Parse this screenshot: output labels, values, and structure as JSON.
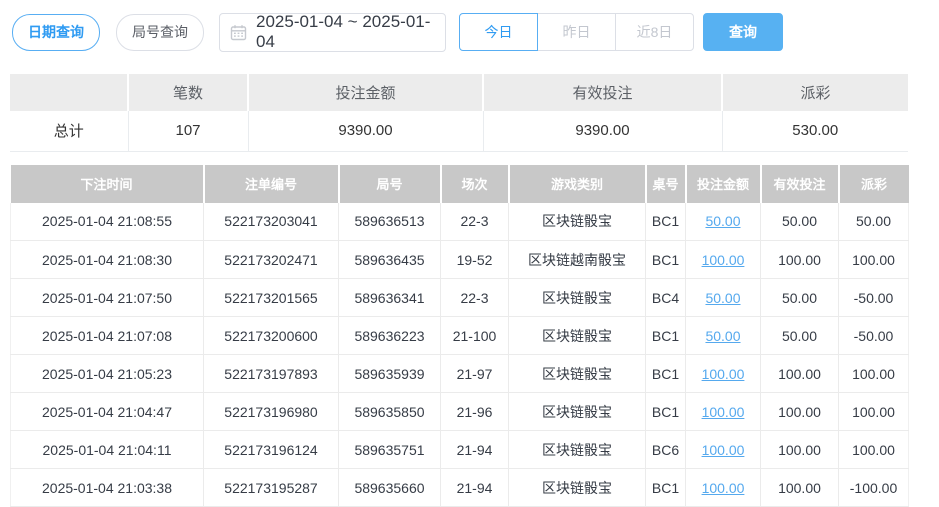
{
  "toolbar": {
    "date_query_label": "日期查询",
    "round_query_label": "局号查询",
    "calendar_icon": "calendar",
    "date_range": "2025-01-04 ~ 2025-01-04",
    "quick_buttons": [
      {
        "label": "今日",
        "active": true
      },
      {
        "label": "昨日",
        "active": false
      },
      {
        "label": "近8日",
        "active": false
      }
    ],
    "search_label": "查询"
  },
  "summary": {
    "headers": [
      "",
      "笔数",
      "投注金额",
      "有效投注",
      "派彩"
    ],
    "row_label": "总计",
    "values": [
      "107",
      "9390.00",
      "9390.00",
      "530.00"
    ]
  },
  "table": {
    "headers": [
      "下注时间",
      "注单编号",
      "局号",
      "场次",
      "游戏类别",
      "桌号",
      "投注金额",
      "有效投注",
      "派彩"
    ],
    "rows": [
      {
        "time": "2025-01-04 21:08:55",
        "order_no": "522173203041",
        "round_no": "589636513",
        "session": "22-3",
        "game": "区块链骰宝",
        "table_no": "BC1",
        "bet": "50.00",
        "valid": "50.00",
        "payout": "50.00"
      },
      {
        "time": "2025-01-04 21:08:30",
        "order_no": "522173202471",
        "round_no": "589636435",
        "session": "19-52",
        "game": "区块链越南骰宝",
        "table_no": "BC1",
        "bet": "100.00",
        "valid": "100.00",
        "payout": "100.00"
      },
      {
        "time": "2025-01-04 21:07:50",
        "order_no": "522173201565",
        "round_no": "589636341",
        "session": "22-3",
        "game": "区块链骰宝",
        "table_no": "BC4",
        "bet": "50.00",
        "valid": "50.00",
        "payout": "-50.00"
      },
      {
        "time": "2025-01-04 21:07:08",
        "order_no": "522173200600",
        "round_no": "589636223",
        "session": "21-100",
        "game": "区块链骰宝",
        "table_no": "BC1",
        "bet": "50.00",
        "valid": "50.00",
        "payout": "-50.00"
      },
      {
        "time": "2025-01-04 21:05:23",
        "order_no": "522173197893",
        "round_no": "589635939",
        "session": "21-97",
        "game": "区块链骰宝",
        "table_no": "BC1",
        "bet": "100.00",
        "valid": "100.00",
        "payout": "100.00"
      },
      {
        "time": "2025-01-04 21:04:47",
        "order_no": "522173196980",
        "round_no": "589635850",
        "session": "21-96",
        "game": "区块链骰宝",
        "table_no": "BC1",
        "bet": "100.00",
        "valid": "100.00",
        "payout": "100.00"
      },
      {
        "time": "2025-01-04 21:04:11",
        "order_no": "522173196124",
        "round_no": "589635751",
        "session": "21-94",
        "game": "区块链骰宝",
        "table_no": "BC6",
        "bet": "100.00",
        "valid": "100.00",
        "payout": "100.00"
      },
      {
        "time": "2025-01-04 21:03:38",
        "order_no": "522173195287",
        "round_no": "589635660",
        "session": "21-94",
        "game": "区块链骰宝",
        "table_no": "BC1",
        "bet": "100.00",
        "valid": "100.00",
        "payout": "-100.00"
      }
    ]
  },
  "colors": {
    "accent_blue": "#57b1f2",
    "link_blue": "#55a9ee",
    "negative_red": "#f0525a",
    "table_header_bg": "#c8c8c8",
    "summary_header_bg": "#ececec"
  }
}
